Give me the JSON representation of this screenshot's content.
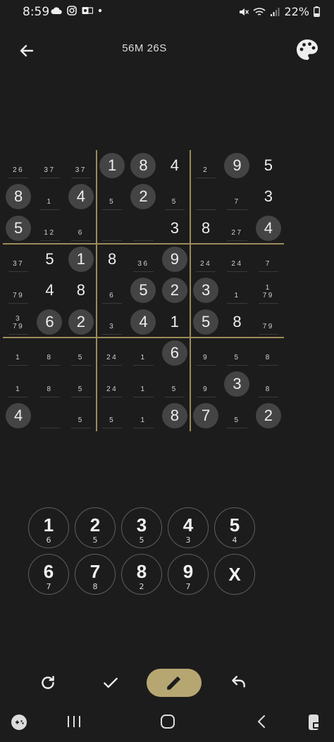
{
  "status_bar": {
    "time": "8:59",
    "battery": "22%"
  },
  "header": {
    "timer": "56M 26S",
    "icons": [
      "arrow-left-icon",
      "palette-icon"
    ]
  },
  "colors": {
    "background": "#1c1c1c",
    "accent": "#b6a772",
    "box_lines": "#9c8a5a",
    "filled_circle": "#444444"
  },
  "board": {
    "cells": [
      [
        {
          "n": "26"
        },
        {
          "n": "37"
        },
        {
          "n": "37"
        },
        {
          "v": "1",
          "c": true
        },
        {
          "v": "8",
          "c": true
        },
        {
          "v": "4"
        },
        {
          "n": "2"
        },
        {
          "v": "9",
          "c": true
        },
        {
          "v": "5"
        }
      ],
      [
        {
          "v": "8",
          "c": true
        },
        {
          "n": "1"
        },
        {
          "v": "4",
          "c": true
        },
        {
          "n": "5"
        },
        {
          "v": "2",
          "c": true
        },
        {
          "n": "5"
        },
        {
          "n": ""
        },
        {
          "n": "7"
        },
        {
          "v": "3"
        }
      ],
      [
        {
          "v": "5",
          "c": true
        },
        {
          "n": "12"
        },
        {
          "n": "6"
        },
        {
          "n": ""
        },
        {
          "n": ""
        },
        {
          "v": "3"
        },
        {
          "v": "8"
        },
        {
          "n": "27"
        },
        {
          "v": "4",
          "c": true
        }
      ],
      [
        {
          "n": "37"
        },
        {
          "v": "5"
        },
        {
          "v": "1",
          "c": true
        },
        {
          "v": "8"
        },
        {
          "n": "36"
        },
        {
          "v": "9",
          "c": true
        },
        {
          "n": "24"
        },
        {
          "n": "24"
        },
        {
          "n": "7"
        }
      ],
      [
        {
          "n": "79"
        },
        {
          "v": "4"
        },
        {
          "v": "8"
        },
        {
          "n": "6"
        },
        {
          "v": "5",
          "c": true
        },
        {
          "v": "2",
          "c": true
        },
        {
          "v": "3",
          "c": true
        },
        {
          "n": "1"
        },
        {
          "n": "1\n79"
        }
      ],
      [
        {
          "n": "3\n79"
        },
        {
          "v": "6",
          "c": true
        },
        {
          "v": "2",
          "c": true
        },
        {
          "n": "3"
        },
        {
          "v": "4",
          "c": true
        },
        {
          "v": "1"
        },
        {
          "v": "5",
          "c": true
        },
        {
          "v": "8"
        },
        {
          "n": "79"
        }
      ],
      [
        {
          "n": "1"
        },
        {
          "n": "8"
        },
        {
          "n": "5"
        },
        {
          "n": "24"
        },
        {
          "n": "1"
        },
        {
          "v": "6",
          "c": true
        },
        {
          "n": "9"
        },
        {
          "n": "5"
        },
        {
          "n": "8"
        }
      ],
      [
        {
          "n": "1"
        },
        {
          "n": "8"
        },
        {
          "n": "5"
        },
        {
          "n": "24"
        },
        {
          "n": "1"
        },
        {
          "n": "5"
        },
        {
          "n": "9"
        },
        {
          "v": "3",
          "c": true
        },
        {
          "n": "8"
        }
      ],
      [
        {
          "v": "4",
          "c": true
        },
        {
          "n": ""
        },
        {
          "n": "5"
        },
        {
          "n": "5"
        },
        {
          "n": "1"
        },
        {
          "v": "8",
          "c": true
        },
        {
          "v": "7",
          "c": true
        },
        {
          "n": "5"
        },
        {
          "v": "2",
          "c": true
        }
      ]
    ]
  },
  "numpad": [
    {
      "digit": "1",
      "count": "6"
    },
    {
      "digit": "2",
      "count": "5"
    },
    {
      "digit": "3",
      "count": "5"
    },
    {
      "digit": "4",
      "count": "3"
    },
    {
      "digit": "5",
      "count": "4"
    },
    {
      "digit": "6",
      "count": "7"
    },
    {
      "digit": "7",
      "count": "8"
    },
    {
      "digit": "8",
      "count": "2"
    },
    {
      "digit": "9",
      "count": "7"
    },
    {
      "digit": "X",
      "count": ""
    }
  ],
  "toolbar": {
    "icons": [
      "refresh-icon",
      "check-icon",
      "pencil-icon",
      "undo-icon"
    ]
  }
}
